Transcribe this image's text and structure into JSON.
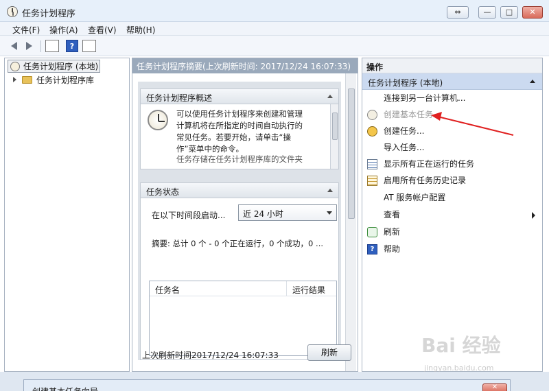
{
  "window": {
    "title": "任务计划程序",
    "buttons": {
      "restore_alt": "⇔",
      "minimize": "—",
      "maximize": "□",
      "close": "✕"
    }
  },
  "menu": [
    "文件(F)",
    "操作(A)",
    "查看(V)",
    "帮助(H)"
  ],
  "toolbar": {
    "help_glyph": "?"
  },
  "tree": {
    "root": "任务计划程序 (本地)",
    "child": "任务计划程序库"
  },
  "center": {
    "header": "任务计划程序摘要(上次刷新时间: 2017/12/24 16:07:33)",
    "overview": {
      "title": "任务计划程序概述",
      "lines": [
        "可以使用任务计划程序来创建和管理",
        "计算机将在所指定的时间自动执行的",
        "常见任务。若要开始，请单击“操",
        "作”菜单中的命令。"
      ],
      "more": "任务存储在任务计划程序库的文件夹"
    },
    "status": {
      "title": "任务状态",
      "label": "在以下时间段启动...",
      "select": "近 24 小时",
      "summary": "摘要: 总计 0 个 - 0 个正在运行，0 个成功，0 ...",
      "columns": [
        "任务名",
        "运行结果"
      ]
    },
    "footer": "上次刷新时间2017/12/24 16:07:33",
    "refresh": "刷新"
  },
  "actions": {
    "title": "操作",
    "group": "任务计划程序 (本地)",
    "items": [
      {
        "label": "连接到另一台计算机...",
        "icon": "none"
      },
      {
        "label": "创建基本任务...",
        "icon": "clock-icon",
        "disabled": true
      },
      {
        "label": "创建任务...",
        "icon": "task-icon"
      },
      {
        "label": "导入任务...",
        "icon": "none"
      },
      {
        "label": "显示所有正在运行的任务",
        "icon": "list-icon"
      },
      {
        "label": "启用所有任务历史记录",
        "icon": "history-icon"
      },
      {
        "label": "AT 服务帐户配置",
        "icon": "none"
      },
      {
        "label": "查看",
        "icon": "none",
        "submenu": true
      },
      {
        "label": "刷新",
        "icon": "refresh-icon"
      },
      {
        "label": "帮助",
        "icon": "help-icon"
      }
    ]
  },
  "dialog": {
    "title": "创建基本任务向导",
    "close": "✕"
  },
  "watermark": {
    "logo": "Bai 经验",
    "url": "jingyan.baidu.com"
  },
  "colors": {
    "header": "#9aa9bb",
    "group": "#cbdaf0",
    "arrow": "#e02020"
  }
}
